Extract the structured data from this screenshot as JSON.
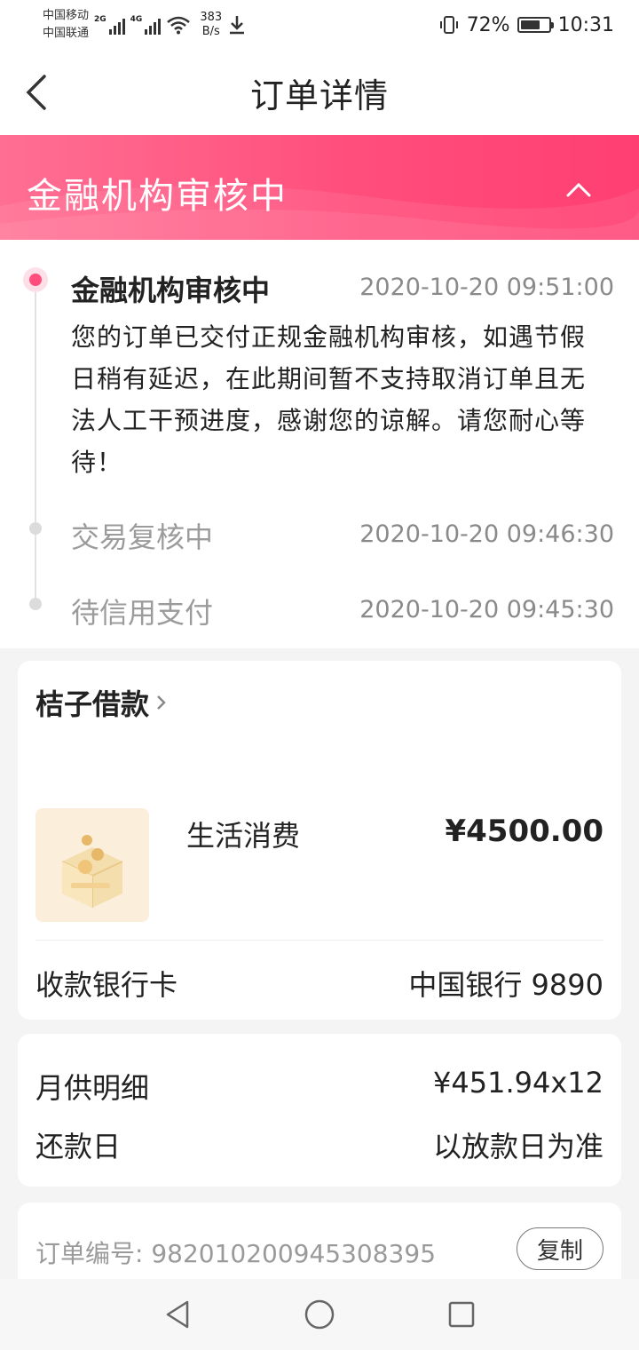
{
  "status_bar": {
    "carrier_1": "中国移动",
    "carrier_2": "中国联通",
    "sig1_tag": "2G",
    "sig2_tag": "4G",
    "speed_value": "383",
    "speed_unit": "B/s",
    "battery_percent": "72%",
    "battery_level": 0.72,
    "time": "10:31"
  },
  "header": {
    "title": "订单详情",
    "back_icon": "chevron-left-icon"
  },
  "banner": {
    "status": "金融机构审核中",
    "toggle_icon": "chevron-up-icon",
    "colors": {
      "start": "#ff6f93",
      "end": "#ff3f72"
    }
  },
  "timeline": {
    "items": [
      {
        "title": "金融机构审核中",
        "time": "2020-10-20 09:51:00",
        "description": "您的订单已交付正规金融机构审核，如遇节假日稍有延迟，在此期间暂不支持取消订单且无法人工干预进度，感谢您的谅解。请您耐心等待！",
        "active": true
      },
      {
        "title": "交易复核中",
        "time": "2020-10-20 09:46:30",
        "active": false
      },
      {
        "title": "待信用支付",
        "time": "2020-10-20 09:45:30",
        "active": false
      }
    ],
    "accent_color": "#ff4d7d"
  },
  "loan_card": {
    "lender": "桔子借款",
    "product_name": "生活消费",
    "amount": "¥4500.00",
    "bank_label": "收款银行卡",
    "bank_value": "中国银行 9890",
    "product_icon": "coin-box-icon"
  },
  "repay_card": {
    "monthly_label": "月供明细",
    "monthly_value": "¥451.94x12",
    "repay_day_label": "还款日",
    "repay_day_value": "以放款日为准"
  },
  "order_card": {
    "order_no_label": "订单编号:",
    "order_no": "982010200945308395",
    "copy_label": "复制"
  },
  "nav": {
    "back_icon": "triangle-back-icon",
    "home_icon": "circle-home-icon",
    "recents_icon": "square-recents-icon"
  }
}
